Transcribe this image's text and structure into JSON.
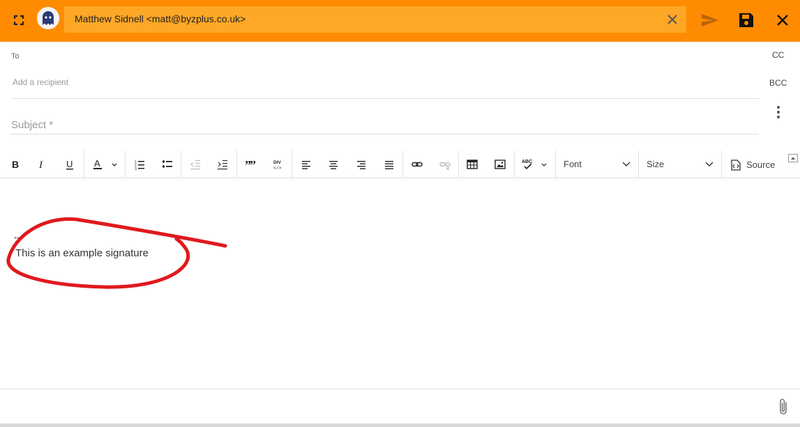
{
  "header": {
    "from": "Matthew Sidnell <matt@byzplus.co.uk>",
    "accent_color": "#ff8c00",
    "field_color": "#ffa726",
    "icons": [
      "expand-icon",
      "ghost-avatar",
      "clear-icon",
      "send-icon",
      "save-icon",
      "close-icon"
    ]
  },
  "recipients": {
    "to_label": "To",
    "placeholder": "Add a recipient",
    "cc_label": "CC",
    "bcc_label": "BCC"
  },
  "subject": {
    "placeholder": "Subject *",
    "value": ""
  },
  "toolbar": {
    "font_label": "Font",
    "size_label": "Size",
    "source_label": "Source"
  },
  "body": {
    "signature_separator": "--",
    "signature_text": "This is an example signature",
    "annotation_color": "#e0191e"
  }
}
